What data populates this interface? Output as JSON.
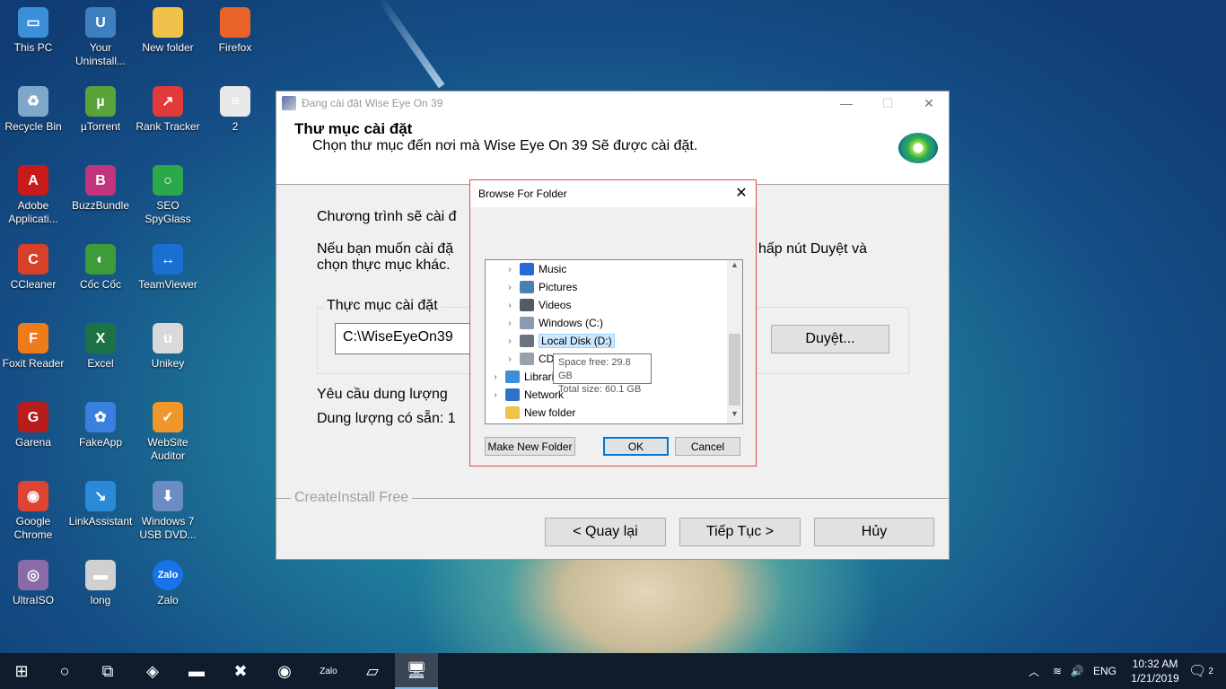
{
  "desktop": {
    "icons": [
      {
        "label": "This PC",
        "glyph": "▭",
        "color": "#3a8fd8"
      },
      {
        "label": "Your Uninstall...",
        "glyph": "U",
        "color": "#3f7fbf"
      },
      {
        "label": "New folder",
        "glyph": "",
        "color": "#f0c24b"
      },
      {
        "label": "Firefox",
        "glyph": "",
        "color": "#e8622a"
      },
      {
        "label": "Recycle Bin",
        "glyph": "♻",
        "color": "#7fa7c9"
      },
      {
        "label": "µTorrent",
        "glyph": "µ",
        "color": "#58a33a"
      },
      {
        "label": "Rank Tracker",
        "glyph": "↗",
        "color": "#e23a3a"
      },
      {
        "label": "2",
        "glyph": "≡",
        "color": "#e8e8e8"
      },
      {
        "label": "Adobe Applicati...",
        "glyph": "A",
        "color": "#c81a1a"
      },
      {
        "label": "BuzzBundle",
        "glyph": "B",
        "color": "#c2347e"
      },
      {
        "label": "SEO SpyGlass",
        "glyph": "○",
        "color": "#2aa84a"
      },
      {
        "label": "CCleaner",
        "glyph": "C",
        "color": "#d8402a"
      },
      {
        "label": "Cốc Cốc",
        "glyph": "◐",
        "color": "#3d9b3a"
      },
      {
        "label": "TeamViewer",
        "glyph": "↔",
        "color": "#1b6fd1"
      },
      {
        "label": "Foxit Reader",
        "glyph": "F",
        "color": "#f07b1a"
      },
      {
        "label": "Excel",
        "glyph": "X",
        "color": "#1d7245"
      },
      {
        "label": "Unikey",
        "glyph": "u",
        "color": "#d9d9d9"
      },
      {
        "label": "Garena",
        "glyph": "G",
        "color": "#b81d1d"
      },
      {
        "label": "FakeApp",
        "glyph": "✿",
        "color": "#3b7fe0"
      },
      {
        "label": "WebSite Auditor",
        "glyph": "✓",
        "color": "#f0962a"
      },
      {
        "label": "Google Chrome",
        "glyph": "◉",
        "color": "#dc4434"
      },
      {
        "label": "LinkAssistant",
        "glyph": "↘",
        "color": "#2a8ad8"
      },
      {
        "label": "Windows 7 USB DVD...",
        "glyph": "⬇",
        "color": "#6c8cc4"
      },
      {
        "label": "UltraISO",
        "glyph": "◎",
        "color": "#8a6aa8"
      },
      {
        "label": "long",
        "glyph": "▬",
        "color": "#d0d0d0"
      },
      {
        "label": "Zalo",
        "glyph": "Zalo",
        "color": "#1673e8"
      }
    ]
  },
  "installer": {
    "title": "Đang cài đặt Wise Eye On 39",
    "controls": {
      "minimize": "—",
      "maximize": "☐",
      "close": "✕"
    },
    "heading": "Thư mục cài đặt",
    "subheading": "Chọn thư mục đến nơi mà Wise Eye On 39 Sẽ được cài đặt.",
    "line1": "Chương trình sẽ cài đ",
    "line2a": "Nếu bạn muốn cài đặ",
    "line2b": "hấp nút Duyệt và",
    "line3": "chọn thực mục khác.",
    "group_label": "Thực mục cài đặt",
    "path_value": "C:\\WiseEyeOn39",
    "browse_button": "Duyệt...",
    "required_space": "Yêu cầu dung lượng",
    "available_space": "Dung lượng có sẵn: 1",
    "brand": "CreateInstall Free",
    "back_button": "< Quay lại",
    "next_button": "Tiếp Tục >",
    "cancel_button": "Hủy"
  },
  "browse_dialog": {
    "title": "Browse For Folder",
    "close": "✕",
    "tree": [
      {
        "label": "Music",
        "indent": 1,
        "expandable": true,
        "icon_color": "#2a6ad8"
      },
      {
        "label": "Pictures",
        "indent": 1,
        "expandable": true,
        "icon_color": "#4a7fb0"
      },
      {
        "label": "Videos",
        "indent": 1,
        "expandable": true,
        "icon_color": "#555a66"
      },
      {
        "label": "Windows (C:)",
        "indent": 1,
        "expandable": true,
        "icon_color": "#8a9bb0"
      },
      {
        "label": "Local Disk (D:)",
        "indent": 1,
        "expandable": true,
        "icon_color": "#6b7280",
        "selected": true
      },
      {
        "label": "CD",
        "indent": 1,
        "expandable": true,
        "icon_color": "#9aa0a8"
      },
      {
        "label": "Librari",
        "indent": 0,
        "expandable": true,
        "icon_color": "#3a8fd8"
      },
      {
        "label": "Network",
        "indent": 0,
        "expandable": true,
        "icon_color": "#2a73c8"
      },
      {
        "label": "New folder",
        "indent": 0,
        "expandable": false,
        "icon_color": "#f0c24b"
      }
    ],
    "tooltip": {
      "space_free": "Space free: 29.8 GB",
      "total_size": "Total size: 60.1 GB"
    },
    "make_new_folder": "Make New Folder",
    "ok": "OK",
    "cancel": "Cancel"
  },
  "taskbar": {
    "start_icon": "⊞",
    "search_icon": "○",
    "taskview_icon": "⧉",
    "apps": [
      "◈",
      "▬",
      "✖",
      "◉",
      "Zalo",
      "▱",
      "🖥"
    ],
    "tray": {
      "chevron": "︿",
      "wifi": "≋",
      "volume": "🔊",
      "language": "ENG",
      "notifications": "2"
    },
    "time": "10:32 AM",
    "date": "1/21/2019"
  }
}
